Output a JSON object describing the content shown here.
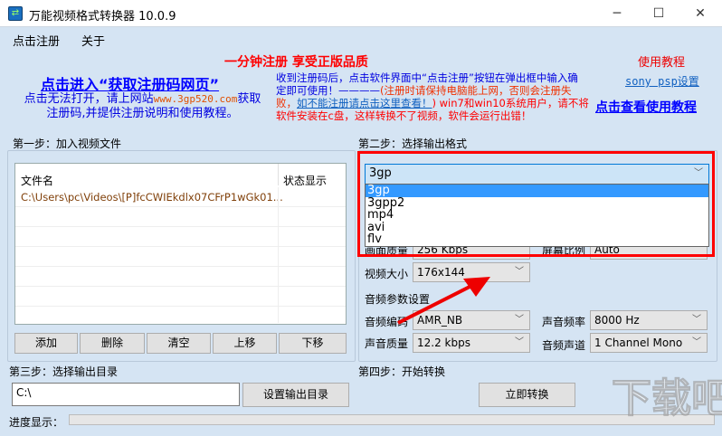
{
  "window": {
    "title": "万能视频格式转换器 10.0.9",
    "controls": [
      "minimize",
      "maximize",
      "close"
    ]
  },
  "menu": [
    "点击注册",
    "关于"
  ],
  "promo": {
    "headline": "一分钟注册  享受正版品质",
    "get_code_link": "点击进入“获取注册码网页”",
    "fallback_pre": "点击无法打开，请上网站",
    "fallback_site": "www.3gp520.com",
    "fallback_post": "获取",
    "fallback_line2": "注册码,并提供注册说明和使用教程。",
    "notice_blue1": "收到注册码后，点击软件界面中“点击注册”按钮在弹出框中输入确",
    "notice_blue2": "定即可使用！————",
    "notice_red1": "(注册时请保持电脑能上网，否则会注册失",
    "notice_red2": "败，",
    "notice_link": "如不能注册请点击这里查看！",
    "notice_red3": ") win7和win10系统用户，请不将",
    "notice_red4": "软件安装在c盘，这样转换不了视频，软件会运行出错！",
    "tutorial_label": "使用教程",
    "psp_link": "sony psp设置",
    "tutorial_link": "点击查看使用教程"
  },
  "step1": {
    "label": "第一步：加入视频文件",
    "columns": [
      "文件名",
      "状态显示"
    ],
    "rows": [
      {
        "file": "C:\\Users\\pc\\Videos\\[P]fcCWIEkdlx07CFrP1wGk01...",
        "status": ""
      }
    ],
    "buttons": [
      "添加",
      "删除",
      "清空",
      "上移",
      "下移"
    ]
  },
  "step2": {
    "label": "第二步：选择输出格式",
    "format": "3gp",
    "format_options": [
      "3gp",
      "3gpp2",
      "mp4",
      "avi",
      "flv"
    ],
    "video_quality_label": "画面质量",
    "video_quality": "256 Kbps",
    "aspect_label": "屏幕比例",
    "aspect": "Auto",
    "video_size_label": "视频大小",
    "video_size": "176x144",
    "audio_section": "音频参数设置",
    "audio_codec_label": "音频编码",
    "audio_codec": "AMR_NB",
    "sample_rate_label": "声音频率",
    "sample_rate": "8000 Hz",
    "audio_quality_label": "声音质量",
    "audio_quality": "12.2 kbps",
    "channel_label": "音频声道",
    "channel": "1 Channel Mono"
  },
  "step3": {
    "label": "第三步：选择输出目录",
    "path": "C:\\",
    "button": "设置输出目录"
  },
  "step4": {
    "label": "第四步：开始转换",
    "button": "立即转换"
  },
  "progress": {
    "label": "进度显示：",
    "value": 0
  },
  "watermark": "下载吧 www.xiazaiba.com"
}
